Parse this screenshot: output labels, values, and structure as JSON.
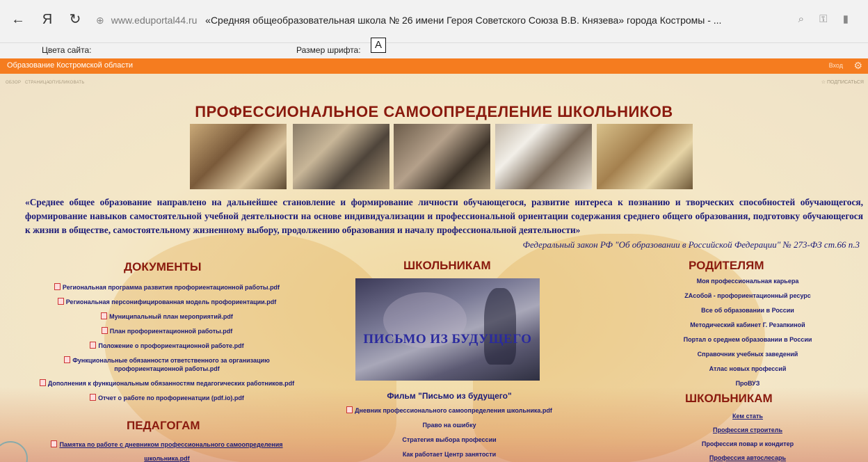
{
  "browser": {
    "back": "←",
    "yandex": "Я",
    "reload": "↻",
    "site_icon": "⊕",
    "domain": "www.eduportal44.ru",
    "page_title": "«Средняя общеобразовательная школа № 26 имени Героя Советского Союза В.В. Князева» города Костромы - ...",
    "icons": [
      "search-icon",
      "key-icon",
      "bookmark-icon"
    ]
  },
  "site_tools": {
    "colors_label": "Цвета сайта:",
    "font_size_label": "Размер шрифта:",
    "font_a": "A"
  },
  "orange_bar": {
    "title": "Образование Костромской области",
    "login": "Вход",
    "gear": "⚙"
  },
  "sp_nav": {
    "links": [
      "ОБЗОР",
      "СТРАНИЦА",
      "ОПУБЛИКОВАТЬ"
    ],
    "subscribe": "☆ ПОДПИСАТЬСЯ"
  },
  "page_title": "ПРОФЕССИОНАЛЬНОЕ САМООПРЕДЕЛЕНИЕ ШКОЛЬНИКОВ",
  "quote": "«Среднее общее образование направлено на дальнейшее становление и формирование личности обучающегося, развитие интереса к познанию и творческих способностей обучающегося, формирование навыков самостоятельной учебной деятельности на основе индивидуализации и профессиональной ориентации содержания среднего общего образования, подготовку обучающегося к жизни в обществе, самостоятельному жизненному выбору, продолжению образования и началу профессиональной деятельности»",
  "law": "Федеральный закон РФ \"Об образовании в Российской Федерации\" № 273-ФЗ ст.66 п.3",
  "documents": {
    "title": "ДОКУМЕНТЫ",
    "items": [
      "Региональная программа развития профориентационной работы.pdf",
      "Региональная персонифицированная модель профориентации.pdf",
      "Муниципальный план мероприятий.pdf",
      "План профориентационной работы.pdf",
      "Положение о профориентационной работе.pdf",
      "Функциональные обязанности ответственного за организацию профориентационной работы.pdf",
      "Дополнения к функциональным обязанностям педагогических работников.pdf",
      "Отчет о работе по профориенатции (pdf.io).pdf"
    ]
  },
  "teachers": {
    "title": "ПЕДАГОГАМ",
    "items": [
      "Памятка по работе с дневником профессионального самоопределения школьника.pdf"
    ]
  },
  "students_mid": {
    "title": "ШКОЛЬНИКАМ",
    "video_text": "ПИСЬМО ИЗ БУДУЩЕГО",
    "film": "Фильм \"Письмо из будущего\"",
    "items": [
      "Дневник профессионального самоопределения школьника.pdf",
      "Право на ошибку",
      "Стратегия выбора профессии",
      "Как работает Центр занятости"
    ]
  },
  "parents": {
    "title": "РОДИТЕЛЯМ",
    "items": [
      "Моя профессиональная карьера",
      "ZAсобой - профориентационный ресурс",
      "Все об образовании в России",
      "Методический кабинет Г. Резапкиной",
      "Портал о среднем образовании в России",
      "Справочник учебных заведений",
      "Атлас новых профессий",
      "ПроВУЗ"
    ]
  },
  "students_right": {
    "title": "ШКОЛЬНИКАМ",
    "items": [
      "Кем стать",
      "Профессия строитель",
      "Профессия повар и кондитер",
      "Профессия автослесарь"
    ]
  },
  "colors": {
    "orange": "#f57c1f",
    "title_red": "#8a1a0e",
    "link_blue": "#1b1a78"
  }
}
